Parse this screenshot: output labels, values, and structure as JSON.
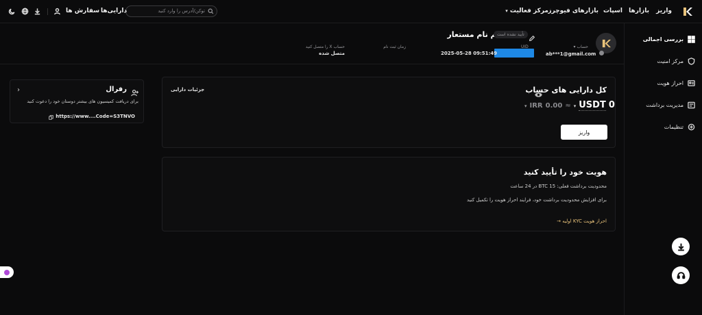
{
  "header": {
    "logo": "K-logo",
    "nav": [
      "واریز",
      "بازارها",
      "اسپات",
      "بازارهای فیوچرز",
      "مرکز فعالیت"
    ],
    "nav_dropdown_arrow": "▾",
    "search_placeholder": "توکن/آدرس را وارد کنید",
    "assets_label": "دارایی‌ها",
    "orders_label": "سفارش ها"
  },
  "sidebar": {
    "items": [
      {
        "label": "بررسی اجمالی",
        "icon": "grid-icon"
      },
      {
        "label": "مرکز امنیت",
        "icon": "shield-icon"
      },
      {
        "label": "احراز هویت",
        "icon": "id-card-icon"
      },
      {
        "label": "مدیریت برداشت",
        "icon": "withdraw-icon"
      },
      {
        "label": "تنظیمات",
        "icon": "settings-icon"
      }
    ]
  },
  "profile": {
    "name": "تنظیم نام مستعار",
    "verify_badge": "تأیید نشده است",
    "account_label": "حساب",
    "account_value": "ab***1@gmail.com",
    "uid_label": "UID",
    "uid_value": "",
    "reg_time_label": "زمان ثبت نام",
    "reg_time_value": "2025-05-28 09:51:49",
    "x_label": "حساب X را متصل کنید",
    "x_value": "متصل شده"
  },
  "balance_card": {
    "title": "کل دارایی های حساب",
    "details_link": "جزئیات دارایی",
    "amount": "0",
    "currency": "USDT",
    "approx_symbol": "≈",
    "fiat_amount": "0.00",
    "fiat_currency": "IRR",
    "deposit_button": "واریز"
  },
  "kyc_card": {
    "title": "هویت خود را تأیید کنید",
    "limit_text": "محدودیت برداشت فعلی: 15 BTC در 24 ساعت",
    "info_text": "برای افزایش محدودیت برداشت خود، فرایند احراز هویت را تکمیل کنید",
    "link_text": "احراز هویت KYC اولیه"
  },
  "referral_card": {
    "title": "رفرال",
    "desc": "برای دریافت کمیسیون های بیشتر دوستان خود را دعوت کنید",
    "link_value": "https://www....Code=S3TNVO"
  },
  "colors": {
    "background": "#0b0b0c",
    "card": "#0e0e0f",
    "accent_link": "#e8c27a",
    "uid_highlight": "#1e88e5"
  }
}
